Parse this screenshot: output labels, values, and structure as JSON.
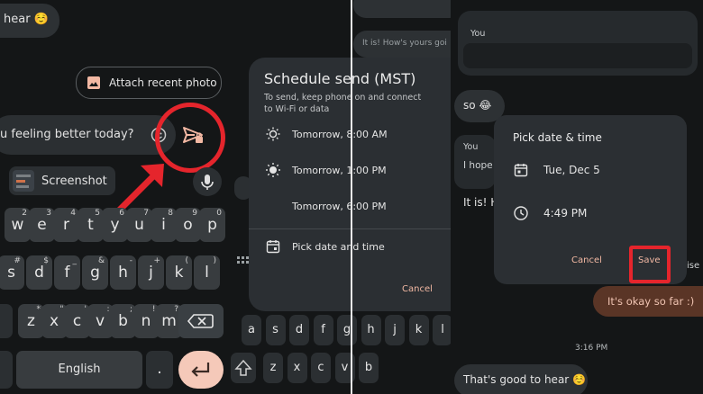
{
  "panel1": {
    "bubble_text": "hear ☺️",
    "attach_chip": "Attach recent photo",
    "compose_text": "u feeling better today?",
    "clip_label": "Screenshot",
    "space_label": "English",
    "period_key": ".",
    "keys_row1": [
      {
        "c": "w",
        "h": "2"
      },
      {
        "c": "e",
        "h": "3"
      },
      {
        "c": "r",
        "h": "4"
      },
      {
        "c": "t",
        "h": "5"
      },
      {
        "c": "y",
        "h": "6"
      },
      {
        "c": "u",
        "h": "7"
      },
      {
        "c": "i",
        "h": "8"
      },
      {
        "c": "o",
        "h": "9"
      },
      {
        "c": "p",
        "h": "0"
      }
    ],
    "keys_row2": [
      {
        "c": "s",
        "h": "#"
      },
      {
        "c": "d",
        "h": "$"
      },
      {
        "c": "f",
        "h": "_"
      },
      {
        "c": "g",
        "h": "&"
      },
      {
        "c": "h",
        "h": "-"
      },
      {
        "c": "j",
        "h": "+"
      },
      {
        "c": "k",
        "h": "("
      },
      {
        "c": "l",
        "h": ")"
      }
    ],
    "keys_row3": [
      {
        "c": "z",
        "h": "*"
      },
      {
        "c": "x",
        "h": "\""
      },
      {
        "c": "c",
        "h": "'"
      },
      {
        "c": "v",
        "h": ":"
      },
      {
        "c": "b",
        "h": ";"
      },
      {
        "c": "n",
        "h": "!"
      },
      {
        "c": "m",
        "h": "?"
      }
    ]
  },
  "panel2": {
    "bg_bubble_text": "It is! How's yours goi",
    "keys_row": [
      "a",
      "s",
      "d",
      "f",
      "g",
      "h",
      "j",
      "k",
      "l"
    ],
    "keys_row_bottom": [
      "z",
      "x",
      "c",
      "v",
      "b"
    ],
    "dialog": {
      "title": "Schedule send (MST)",
      "subtitle": "To send, keep phone on and connect to Wi-Fi or data",
      "options": [
        {
          "icon": "sunrise-icon",
          "label": "Tomorrow, 8:00 AM"
        },
        {
          "icon": "sun-icon",
          "label": "Tomorrow, 1:00 PM"
        },
        {
          "icon": "moon-icon",
          "label": "Tomorrow, 6:00 PM"
        }
      ],
      "pick_label": "Pick date and time",
      "cancel_label": "Cancel"
    }
  },
  "panel3": {
    "you_label": "You",
    "msg_so": "so 😂",
    "you_label_2": "You",
    "hope_text": "I hope",
    "it_is_text": "It is! H",
    "sent_text": "It's okay so far :)",
    "timestamp": "3:16 PM",
    "last_text": "That's good to hear ☺️",
    "side_letters": "ise",
    "dialog": {
      "title": "Pick date & time",
      "date": "Tue, Dec 5",
      "time": "4:49 PM",
      "cancel_label": "Cancel",
      "save_label": "Save"
    }
  },
  "colors": {
    "highlight_red": "#e5252c",
    "accent_orange": "#f2b8a3",
    "enter_key": "#f5c9b9"
  }
}
